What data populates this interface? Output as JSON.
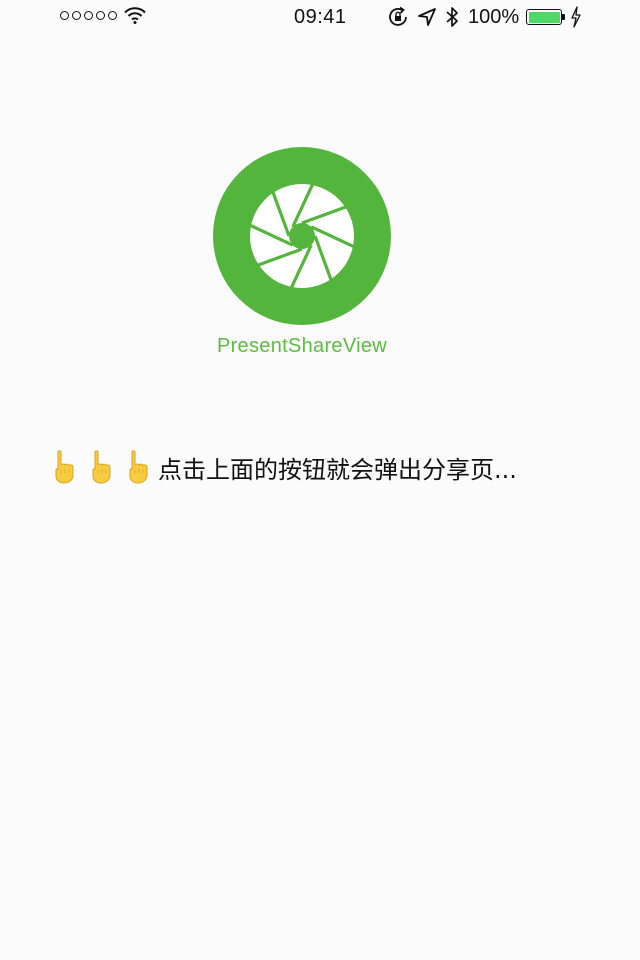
{
  "status_bar": {
    "time": "09:41",
    "battery_percent": "100%",
    "battery_level": 1.0,
    "signal_bars": 0,
    "icons": [
      "signal-dots-icon",
      "wifi-icon",
      "rotation-lock-icon",
      "location-arrow-icon",
      "bluetooth-icon",
      "battery-icon",
      "charging-bolt-icon"
    ]
  },
  "main": {
    "app_name": "PresentShareView",
    "hint_text": "点击上面的按钮就会弹出分享页...",
    "hint_icons": [
      "pointing-up-hand-icon",
      "pointing-up-hand-icon",
      "pointing-up-hand-icon"
    ]
  },
  "colors": {
    "accent": "#53b53c",
    "app_name": "#5bbd40",
    "battery": "#4cd964",
    "background": "#fbfbfb"
  }
}
